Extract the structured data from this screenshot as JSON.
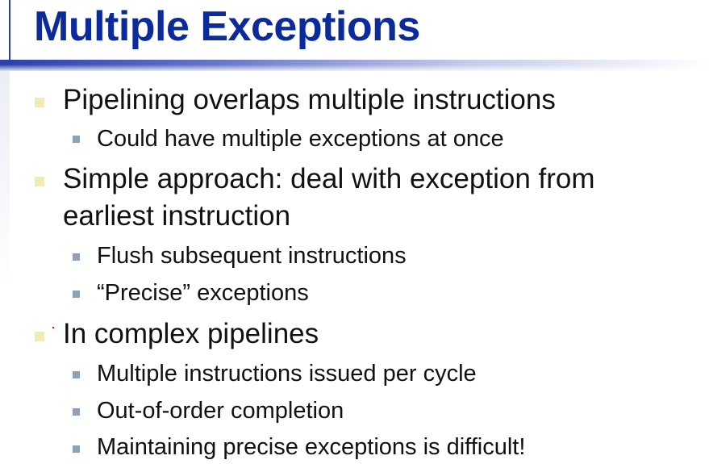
{
  "slide": {
    "title": "Multiple Exceptions",
    "bullets": [
      {
        "text": "Pipelining overlaps multiple instructions",
        "sub": [
          "Could have multiple exceptions at once"
        ]
      },
      {
        "text_line1": "Simple approach: deal with exception from",
        "text_line2": "earliest instruction",
        "sub": [
          "Flush subsequent instructions",
          "“Precise” exceptions"
        ]
      },
      {
        "text": "In complex pipelines",
        "sub": [
          "Multiple instructions issued per cycle",
          "Out-of-order completion",
          "Maintaining precise exceptions is difficult!"
        ]
      }
    ]
  },
  "colors": {
    "title": "#0b2a9c",
    "accent_bar": "#2b3fa8",
    "level1_marker": "#f1eab4",
    "level2_marker": "#8fa0b2",
    "text": "#111111"
  }
}
